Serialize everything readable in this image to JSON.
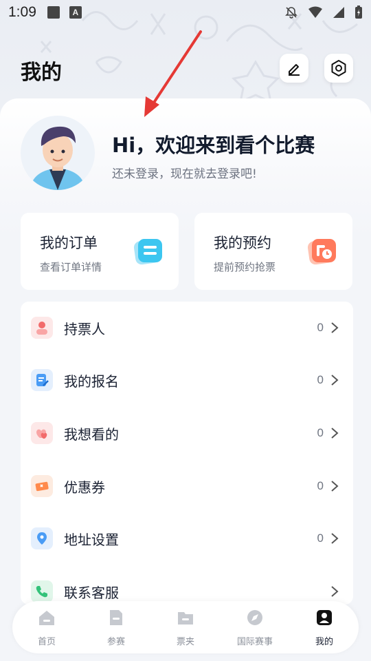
{
  "status_bar": {
    "time": "1:09",
    "a_badge": "A"
  },
  "page_title": "我的",
  "profile": {
    "greeting": "Hi，欢迎来到看个比赛",
    "login_tip": "还未登录，现在就去登录吧!"
  },
  "quick_cards": [
    {
      "title": "我的订单",
      "subtitle": "查看订单详情",
      "icon": "order-icon",
      "color": "#3cc6f0"
    },
    {
      "title": "我的预约",
      "subtitle": "提前预约抢票",
      "icon": "reserve-icon",
      "color": "#ff7a5c"
    }
  ],
  "menu": [
    {
      "label": "持票人",
      "count": "0",
      "icon": "ticket-holder-icon",
      "color": "#f26b6b"
    },
    {
      "label": "我的报名",
      "count": "0",
      "icon": "signup-icon",
      "color": "#4a9cf5"
    },
    {
      "label": "我想看的",
      "count": "0",
      "icon": "favorite-icon",
      "color": "#f26b6b"
    },
    {
      "label": "优惠券",
      "count": "0",
      "icon": "coupon-icon",
      "color": "#ff8a4c"
    },
    {
      "label": "地址设置",
      "count": "0",
      "icon": "location-icon",
      "color": "#4a9cf5"
    },
    {
      "label": "联系客服",
      "count": "",
      "icon": "phone-icon",
      "color": "#34c27a"
    }
  ],
  "tabs": [
    {
      "label": "首页",
      "icon": "home-icon"
    },
    {
      "label": "参赛",
      "icon": "compete-icon"
    },
    {
      "label": "票夹",
      "icon": "ticket-folder-icon"
    },
    {
      "label": "国际赛事",
      "icon": "international-icon"
    },
    {
      "label": "我的",
      "icon": "profile-icon",
      "active": true
    }
  ]
}
